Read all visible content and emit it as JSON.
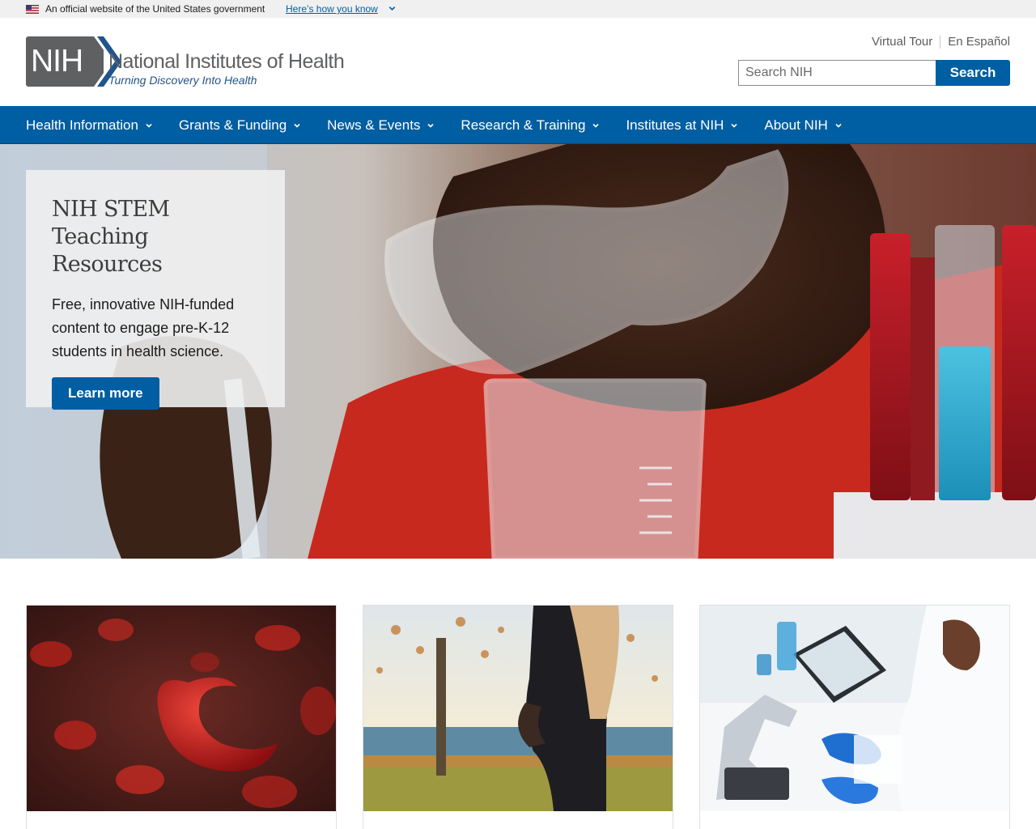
{
  "gov_banner": {
    "text": "An official website of the United States government",
    "link": "Here’s how you know",
    "flag_icon": "us-flag-icon",
    "chevron_icon": "chevron-down-icon"
  },
  "logo": {
    "abbr": "NIH",
    "name": "National Institutes of Health",
    "tagline": "Turning Discovery Into Health"
  },
  "utility_links": [
    "Virtual Tour",
    "En Español"
  ],
  "search": {
    "placeholder": "Search NIH",
    "value": "",
    "button_label": "Search"
  },
  "nav": {
    "items": [
      {
        "label": "Health Information"
      },
      {
        "label": "Grants & Funding"
      },
      {
        "label": "News & Events"
      },
      {
        "label": "Research & Training"
      },
      {
        "label": "Institutes at NIH"
      },
      {
        "label": "About NIH"
      }
    ],
    "chevron_icon": "chevron-down-icon"
  },
  "hero": {
    "title": "NIH STEM Teaching Resources",
    "description": "Free, innovative NIH-funded content to engage pre-K-12 students in health science.",
    "button_label": "Learn more",
    "image": "student-with-goggles-and-beaker-photo"
  },
  "cards": [
    {
      "image": "sickle-red-blood-cell-illustration"
    },
    {
      "image": "pregnant-woman-by-tree-photo"
    },
    {
      "image": "scientist-with-microscope-and-tablet-photo"
    }
  ],
  "colors": {
    "primary": "#005ea2",
    "banner_bg": "#f0f0f0",
    "logo_gray": "#5f6062",
    "tagline_blue": "#20558a"
  }
}
